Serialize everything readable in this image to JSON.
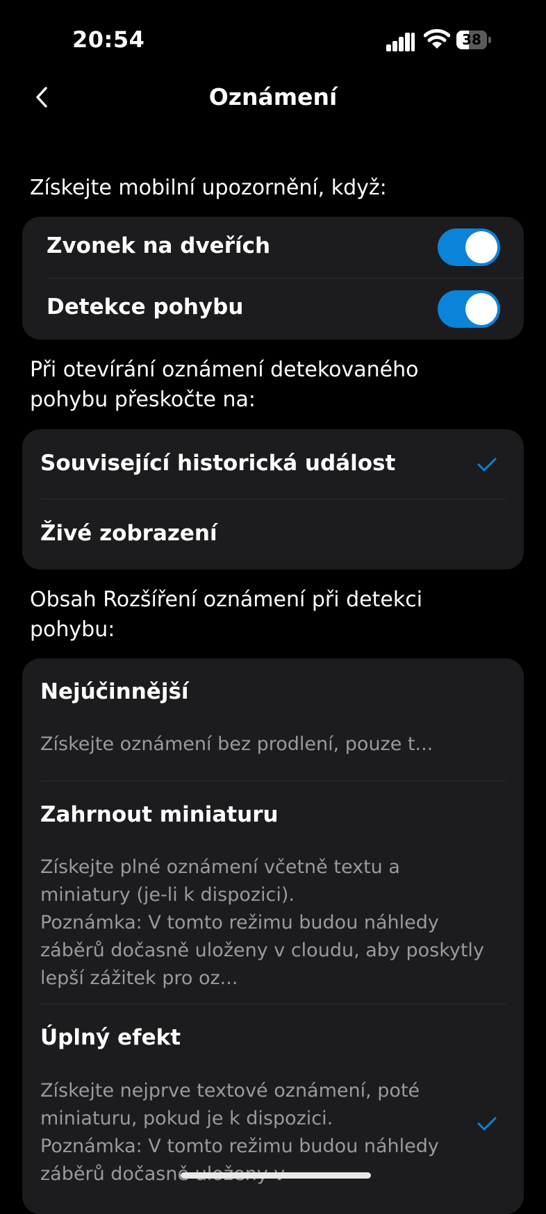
{
  "status": {
    "time": "20:54",
    "battery": "38"
  },
  "nav": {
    "title": "Oznámení"
  },
  "sections": {
    "notify_label": "Získejte mobilní upozornění, když:",
    "jump_label": "Při otevírání oznámení detekovaného pohybu přeskočte na:",
    "content_label": "Obsah Rozšíření oznámení při detekci pohybu:"
  },
  "toggles": [
    {
      "label": "Zvonek na dveřích",
      "on": true
    },
    {
      "label": "Detekce pohybu",
      "on": true
    }
  ],
  "jump_options": [
    {
      "label": "Související historická událost",
      "selected": true
    },
    {
      "label": "Živé zobrazení",
      "selected": false
    }
  ],
  "content_options": [
    {
      "title": "Nejúčinnější",
      "desc": "Získejte oznámení bez prodlení, pouze t...",
      "selected": false
    },
    {
      "title": "Zahrnout miniaturu",
      "desc": "Získejte plné oznámení včetně textu a miniatury (je-li k dispozici).\nPoznámka: V tomto režimu budou náhledy záběrů dočasně uloženy v cloudu, aby poskytly lepší zážitek pro oz...",
      "selected": false
    },
    {
      "title": "Úplný efekt",
      "desc": "Získejte nejprve textové oznámení, poté miniaturu, pokud je k dispozici.\nPoznámka: V tomto režimu budou náhledy záběrů dočasně uloženy v",
      "selected": true
    }
  ],
  "colors": {
    "accent": "#0a84d8",
    "card": "#1c1c1e",
    "secondary_text": "#9a9a9e"
  }
}
